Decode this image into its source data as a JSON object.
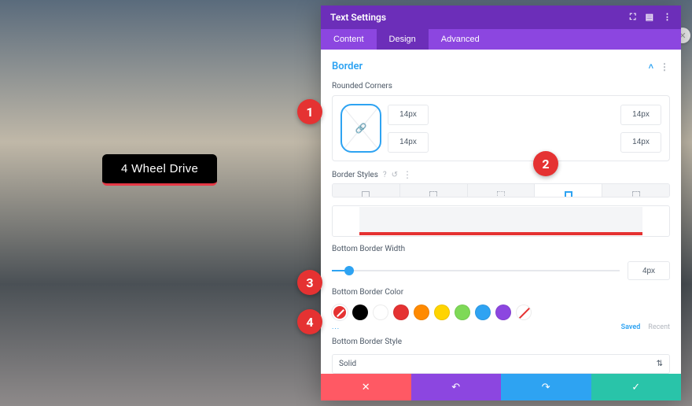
{
  "bg": {
    "label": "4 Wheel Drive"
  },
  "panel": {
    "title": "Text Settings",
    "tabs": {
      "content": "Content",
      "design": "Design",
      "advanced": "Advanced"
    },
    "section": {
      "title": "Border",
      "rounded_label": "Rounded Corners",
      "corners": {
        "tl": "14px",
        "tr": "14px",
        "bl": "14px",
        "br": "14px"
      },
      "styles_label": "Border Styles",
      "width_label": "Bottom Border Width",
      "width_value": "4px",
      "color_label": "Bottom Border Color",
      "style_label": "Bottom Border Style",
      "style_value": "Solid",
      "saved_tab": "Saved",
      "recent_tab": "Recent",
      "more": "..."
    },
    "colors": [
      "#000000",
      "#ffffff",
      "#e53232",
      "#ff8a00",
      "#ffd400",
      "#7ed957",
      "#29c4a9",
      "#2ea3f2",
      "#8c46e0"
    ]
  },
  "callouts": {
    "c1": "1",
    "c2": "2",
    "c3": "3",
    "c4": "4"
  }
}
